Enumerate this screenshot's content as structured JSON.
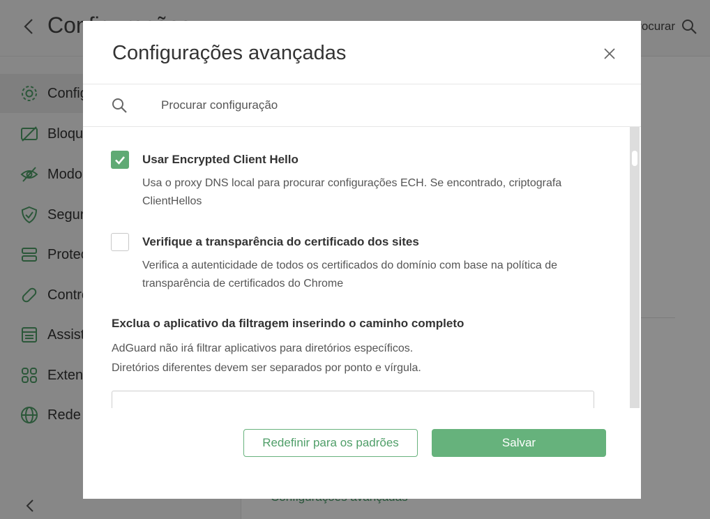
{
  "background": {
    "title": "Configurações",
    "search_label": "Procurar",
    "sidebar": [
      {
        "label": "Configurações gerais",
        "icon": "gear-icon"
      },
      {
        "label": "Bloqueador de anúncios",
        "icon": "ad-block-icon"
      },
      {
        "label": "Modo furtivo",
        "icon": "eye-off-icon"
      },
      {
        "label": "Segurança na navegação",
        "icon": "shield-icon"
      },
      {
        "label": "Proteção DNS",
        "icon": "server-icon"
      },
      {
        "label": "Controle parental",
        "icon": "bandage-icon"
      },
      {
        "label": "Assistente do navegador",
        "icon": "browser-icon"
      },
      {
        "label": "Extensões",
        "icon": "grid-icon"
      },
      {
        "label": "Rede",
        "icon": "globe-icon"
      }
    ],
    "main_link": "Configurações avançadas"
  },
  "modal": {
    "title": "Configurações avançadas",
    "search_placeholder": "Procurar configuração",
    "options": [
      {
        "title": "Usar Encrypted Client Hello",
        "description": "Usa o proxy DNS local para procurar configurações ECH. Se encontrado, criptografa ClientHellos",
        "checked": true
      },
      {
        "title": "Verifique a transparência do certificado dos sites",
        "description": "Verifica a autenticidade de todos os certificados do domínio com base na política de transparência de certificados do Chrome",
        "checked": false
      }
    ],
    "exclude_section": {
      "title": "Exclua o aplicativo da filtragem inserindo o caminho completo",
      "line1": "AdGuard não irá filtrar aplicativos para diretórios específicos.",
      "line2": "Diretórios diferentes devem ser separados por ponto e vírgula.",
      "value": ""
    },
    "reset_label": "Redefinir para os padrões",
    "save_label": "Salvar"
  },
  "colors": {
    "accent": "#66b27c",
    "accent_text": "#4f9e68",
    "overlay": "rgba(0,0,0,0.45)"
  }
}
